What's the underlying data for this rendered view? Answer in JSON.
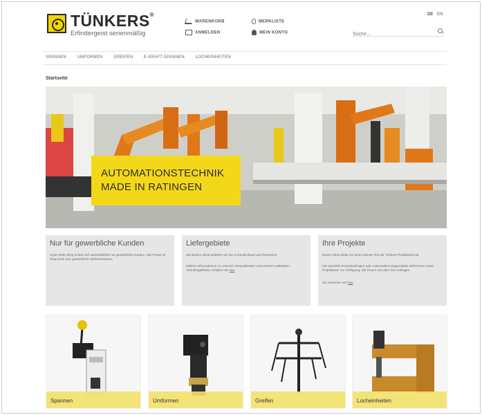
{
  "brand": {
    "name": "TÜNKERS",
    "registered": "®",
    "tagline": "Erfindergeist serienmäßig"
  },
  "header": {
    "cart": "WARENKORB",
    "login": "ANMELDEN",
    "wishlist": "MERKLISTE",
    "account": "MEIN KONTO",
    "lang_de": "DE",
    "lang_en": "EN",
    "search_placeholder": "Suche..."
  },
  "nav": [
    "SPANNEN",
    "UMFORMEN",
    "GREIFEN",
    "E-KRAFT-SPANNEN",
    "LOCHEINHEITEN"
  ],
  "breadcrumb": "Startseite",
  "hero": {
    "line1": "AUTOMATIONSTECHNIK",
    "line2": "MADE IN RATINGEN"
  },
  "info": [
    {
      "title": "Nur für gewerbliche Kunden",
      "p1": "Unser B2B-Shop richtet sich ausschließlich an gewerbliche Kunden, Alle Preise im Shop sind zzgl. gesetzlicher Mehrwertsteuer."
    },
    {
      "title": "Liefergebiete",
      "p1": "Mit diesem Shop beliefern wir Sie in Deutschland und Österreich.",
      "p2": "Nähere Informationen zu unseren Versandkosten und unseren weltweiten Vertriebsgebieten erhalten Sie",
      "p2_link": "hier"
    },
    {
      "title": "Ihre Projekte",
      "p1": "Dieser Shop bildet nur einen kleinen Teil der Tünkers Produktwelt ab.",
      "p2": "Für spezielle Produktanfragen oder Automatisierungsprojekte steht Ihnen unser Projektteam zur Verfügung. Wir freuen uns über Ihre Anfragen.",
      "p3": "Sie erreichen uns",
      "p3_link": "hier"
    }
  ],
  "tiles": [
    "Spannen",
    "Umformen",
    "Greifen",
    "Locheinheiten"
  ],
  "colors": {
    "accent": "#f3d81a",
    "tile_label": "#f3e26a"
  }
}
